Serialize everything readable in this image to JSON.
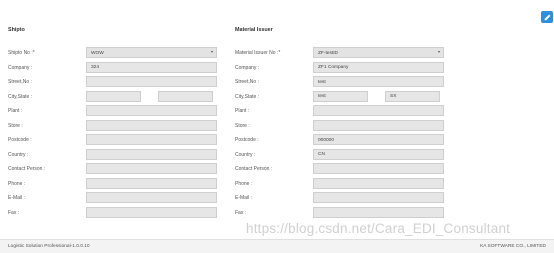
{
  "shipto": {
    "title": "Shipto",
    "fields": [
      {
        "label": "Shipto No :*",
        "value": "WOW",
        "type": "select"
      },
      {
        "label": "Company :",
        "value": "324"
      },
      {
        "label": "Street,No :",
        "value": ""
      },
      {
        "label": "City,State :",
        "value": "",
        "value2": "",
        "type": "split"
      },
      {
        "label": "Plant :",
        "value": ""
      },
      {
        "label": "Store :",
        "value": ""
      },
      {
        "label": "Postcode :",
        "value": ""
      },
      {
        "label": "Country :",
        "value": ""
      },
      {
        "label": "Contact Person :",
        "value": ""
      },
      {
        "label": "Phone :",
        "value": ""
      },
      {
        "label": "E-Mail :",
        "value": ""
      },
      {
        "label": "Fax :",
        "value": ""
      }
    ]
  },
  "issuer": {
    "title": "Material Issuer",
    "fields": [
      {
        "label": "Material Issuer No :*",
        "value": "ZF-testID",
        "type": "select"
      },
      {
        "label": "Company :",
        "value": "ZF1 Company"
      },
      {
        "label": "Street,No :",
        "value": "test"
      },
      {
        "label": "City,State :",
        "value": "test",
        "value2": "SX",
        "type": "split"
      },
      {
        "label": "Plant :",
        "value": ""
      },
      {
        "label": "Store :",
        "value": ""
      },
      {
        "label": "Postcode :",
        "value": "000000"
      },
      {
        "label": "Country :",
        "value": "CN"
      },
      {
        "label": "Contact Person :",
        "value": ""
      },
      {
        "label": "Phone :",
        "value": ""
      },
      {
        "label": "E-Mail :",
        "value": ""
      },
      {
        "label": "Fax :",
        "value": ""
      }
    ]
  },
  "footer": {
    "left": "Logistic Solution Professional-1.0.0.10",
    "right": "KA SOFTWARE CO., LIMITED"
  },
  "watermark": "https://blog.csdn.net/Cara_EDI_Consultant",
  "icons": {
    "edit": "edit-icon"
  },
  "colors": {
    "accent": "#2f8fdc",
    "field_bg": "#e6e6e6"
  }
}
